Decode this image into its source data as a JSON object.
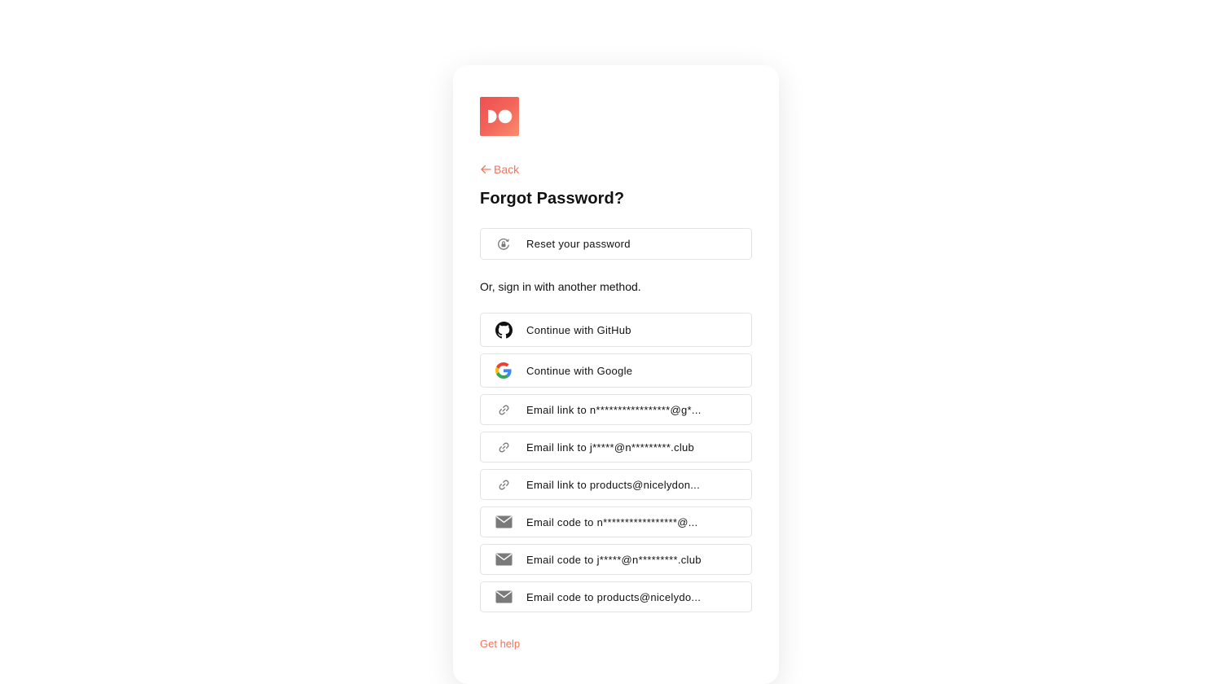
{
  "brand": {
    "accent": "#f2745c",
    "logo_icon": "dribbble-style-do-logo"
  },
  "nav": {
    "back_label": "Back",
    "back_icon": "arrow-left-icon"
  },
  "page": {
    "title": "Forgot Password?",
    "reset_label": "Reset your password",
    "reset_icon": "lock-reset-icon",
    "alt_note": "Or, sign in with another method.",
    "help_label": "Get help"
  },
  "methods": [
    {
      "label": "Continue with GitHub",
      "icon": "github-icon"
    },
    {
      "label": "Continue with Google",
      "icon": "google-icon"
    },
    {
      "label": "Email link to n*****************@g*...",
      "icon": "link-icon"
    },
    {
      "label": "Email link to j*****@n*********.club",
      "icon": "link-icon"
    },
    {
      "label": "Email link to products@nicelydon...",
      "icon": "link-icon"
    },
    {
      "label": "Email code to n*****************@...",
      "icon": "envelope-icon"
    },
    {
      "label": "Email code to j*****@n*********.club",
      "icon": "envelope-icon"
    },
    {
      "label": "Email code to products@nicelydo...",
      "icon": "envelope-icon"
    }
  ]
}
